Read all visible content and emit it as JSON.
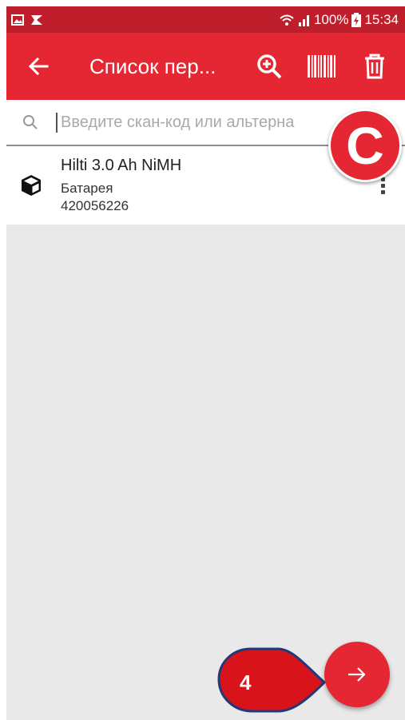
{
  "status_bar": {
    "battery": "100%",
    "time": "15:34"
  },
  "app_bar": {
    "title": "Список пер...",
    "actions": [
      "search-add-icon",
      "barcode-icon",
      "trash-icon"
    ]
  },
  "search": {
    "placeholder": "Введите скан-код или альтерна"
  },
  "items": [
    {
      "title": "Hilti 3.0 Ah NiMH",
      "category": "Батарея",
      "code": "420056226",
      "icon": "box-icon"
    }
  ],
  "overlay": {
    "badge_letter": "C",
    "step_number": "4"
  },
  "colors": {
    "accent": "#e42733",
    "status_bar": "#bf1f2a",
    "background": "#e9e9e9"
  }
}
